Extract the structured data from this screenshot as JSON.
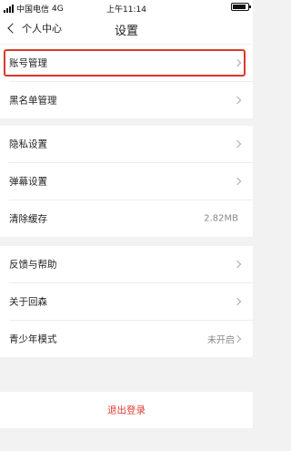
{
  "status_bar": {
    "carrier": "中国电信",
    "network": "4G",
    "time": "上午11:14",
    "battery_level": 0.85
  },
  "nav": {
    "back_label": "个人中心",
    "title": "设置"
  },
  "rows": {
    "account": "账号管理",
    "blacklist": "黑名单管理",
    "privacy": "隐私设置",
    "danmaku": "弹幕设置",
    "clear_cache": "清除缓存",
    "cache_size": "2.82MB",
    "feedback": "反馈与帮助",
    "about": "关于回森",
    "youth_mode": "青少年模式",
    "youth_status": "未开启"
  },
  "logout_label": "退出登录",
  "colors": {
    "highlight": "#d93a2b",
    "logout_text": "#e03a2f",
    "background": "#f2f2f2"
  },
  "icons": [
    "back-chevron-icon",
    "chevron-right-icon",
    "signal-icon",
    "battery-icon"
  ]
}
